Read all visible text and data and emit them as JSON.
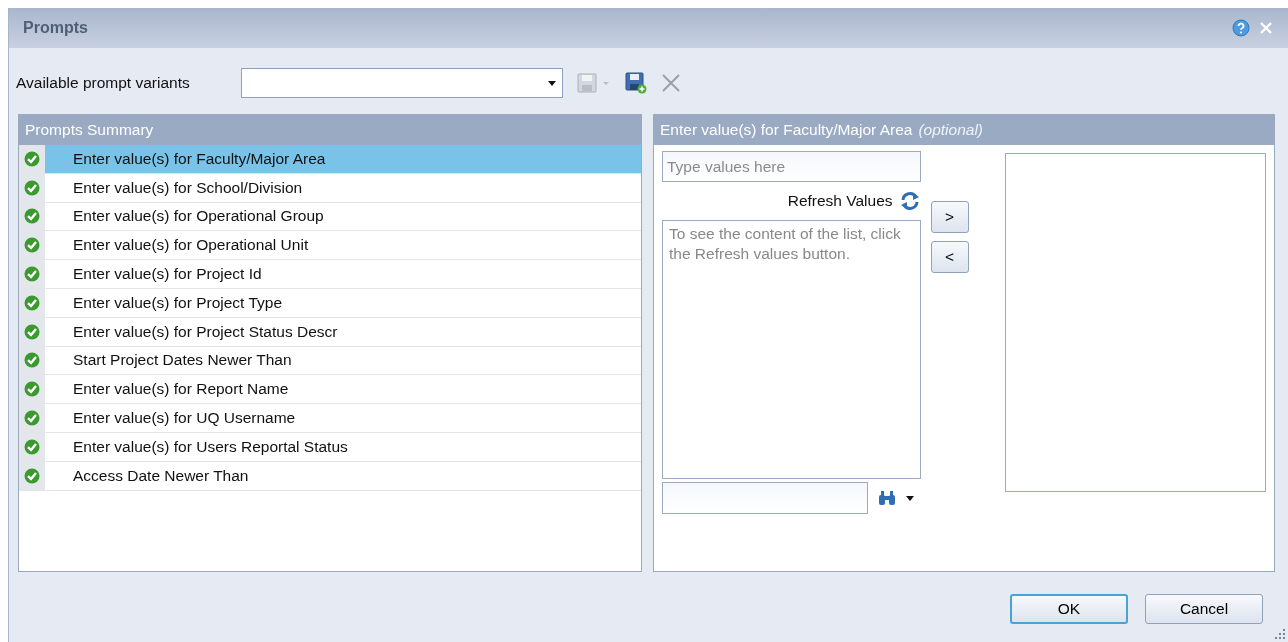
{
  "window": {
    "title": "Prompts"
  },
  "variants": {
    "label": "Available prompt variants"
  },
  "summary": {
    "title": "Prompts Summary",
    "items": [
      {
        "label": "Enter value(s) for Faculty/Major Area",
        "valid": true,
        "selected": true
      },
      {
        "label": "Enter value(s) for School/Division",
        "valid": true,
        "selected": false
      },
      {
        "label": "Enter value(s) for Operational Group",
        "valid": true,
        "selected": false
      },
      {
        "label": "Enter value(s) for Operational Unit",
        "valid": true,
        "selected": false
      },
      {
        "label": "Enter value(s) for Project Id",
        "valid": true,
        "selected": false
      },
      {
        "label": "Enter value(s) for Project Type",
        "valid": true,
        "selected": false
      },
      {
        "label": "Enter value(s) for Project Status Descr",
        "valid": true,
        "selected": false
      },
      {
        "label": "Start Project Dates Newer Than",
        "valid": true,
        "selected": false
      },
      {
        "label": "Enter value(s) for Report Name",
        "valid": true,
        "selected": false
      },
      {
        "label": "Enter value(s) for UQ Username",
        "valid": true,
        "selected": false
      },
      {
        "label": "Enter value(s) for Users Reportal Status",
        "valid": true,
        "selected": false
      },
      {
        "label": "Access Date Newer Than",
        "valid": true,
        "selected": false
      }
    ]
  },
  "detail": {
    "title": "Enter value(s) for Faculty/Major Area",
    "note": "(optional)",
    "search": {
      "placeholder": "Type values here"
    },
    "refresh": "Refresh Values",
    "list_hint": "To see the content of the list, click the Refresh values button.",
    "add": ">",
    "remove": "<"
  },
  "buttons": [
    {
      "label": "OK",
      "default": true
    },
    {
      "label": "Cancel",
      "default": false
    }
  ]
}
